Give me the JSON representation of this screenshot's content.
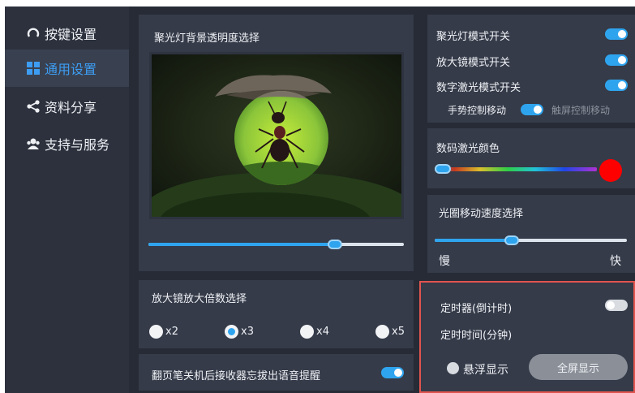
{
  "sidebar": {
    "items": [
      {
        "label": "按键设置",
        "icon": "loop-icon"
      },
      {
        "label": "通用设置",
        "icon": "grid-icon"
      },
      {
        "label": "资料分享",
        "icon": "share-icon"
      },
      {
        "label": "支持与服务",
        "icon": "users-icon"
      }
    ]
  },
  "spotlight_opacity": {
    "title": "聚光灯背景透明度选择",
    "value_fraction": 0.73
  },
  "modes": {
    "spotlight_label": "聚光灯模式开关",
    "spotlight_on": true,
    "magnifier_label": "放大镜模式开关",
    "magnifier_on": true,
    "laser_label": "数字激光模式开关",
    "laser_on": true,
    "gesture_label": "手势控制移动",
    "touch_label": "触屏控制移动",
    "gesture_on": true
  },
  "laser_color": {
    "title": "数码激光颜色",
    "selected_color": "#ff0000"
  },
  "aperture_speed": {
    "title": "光圈移动速度选择",
    "slow_label": "慢",
    "fast_label": "快",
    "value_fraction": 0.4
  },
  "magnification": {
    "title": "放大镜放大倍数选择",
    "options": [
      "x2",
      "x3",
      "x4",
      "x5"
    ],
    "selected": "x3"
  },
  "receiver_reminder": {
    "label": "翻页笔关机后接收器忘拔出语音提醒",
    "on": true
  },
  "timer": {
    "label": "定时器(倒计时)",
    "on": false,
    "minutes_label": "定时时间(分钟)",
    "float_label": "悬浮显示",
    "fullscreen_label": "全屏显示"
  },
  "colors": {
    "accent": "#2fa4ee",
    "highlight_border": "#e0544f"
  }
}
